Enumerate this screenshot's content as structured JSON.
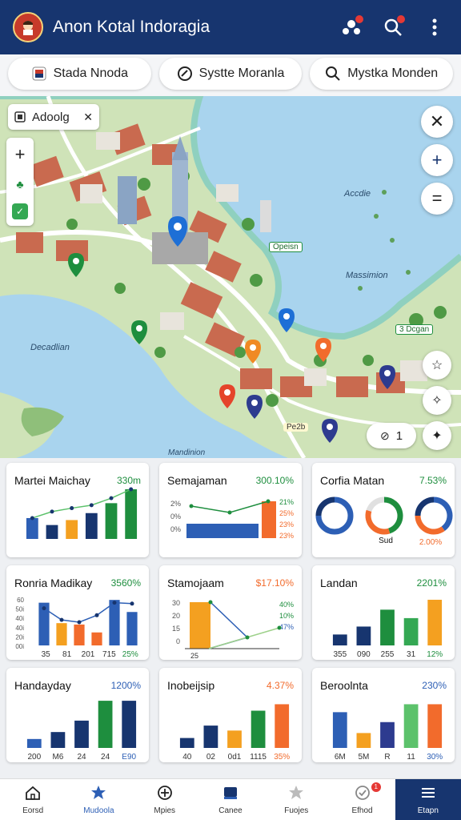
{
  "header": {
    "title": "Anon Kotal Indoragia"
  },
  "filters": [
    {
      "label": "Stada Nnoda",
      "icon": "flag-icon"
    },
    {
      "label": "Systte Moranla",
      "icon": "tag-icon"
    },
    {
      "label": "Mystka Monden",
      "icon": "search-icon"
    }
  ],
  "map": {
    "search_chip": "Adoolg",
    "labels": [
      "Accdie",
      "Massimion",
      "Decadlian",
      "Mandinion",
      "Opeisn",
      "3 Dcgan",
      "Pe2b"
    ],
    "count_badge": "1"
  },
  "cards": [
    {
      "title": "Martei Maichay",
      "value": "330m",
      "value_color": "#1e8e3e",
      "type": "bar-line",
      "values": [
        0.42,
        0.28,
        0.38,
        0.52,
        0.72,
        1.0
      ],
      "colors": [
        "#2d5fb5",
        "#17356f",
        "#f4a020",
        "#17356f",
        "#1e8e3e",
        "#1e8e3e"
      ],
      "line": [
        0.42,
        0.55,
        0.62,
        0.68,
        0.82,
        1.0
      ]
    },
    {
      "title": "Semajaman",
      "value": "300.10%",
      "value_color": "#1e8e3e",
      "type": "hbar",
      "ticks": [
        "2%",
        "0%",
        "0%"
      ],
      "right_ticks": [
        "21%",
        "25%",
        "23%",
        "23%"
      ]
    },
    {
      "title": "Corfia Matan",
      "value": "7.53%",
      "value_color": "#1e8e3e",
      "type": "donut",
      "sub_label": "Sud",
      "sub_value": "2.00%"
    },
    {
      "title": "Ronria Madikay",
      "value": "3560%",
      "value_color": "#1e8e3e",
      "type": "bar-line",
      "values": [
        0.92,
        0.48,
        0.45,
        0.28,
        0.98,
        0.72
      ],
      "colors": [
        "#2d5fb5",
        "#f4a020",
        "#f26b2c",
        "#f26b2c",
        "#2d5fb5",
        "#2d5fb5"
      ],
      "line": [
        0.8,
        0.55,
        0.5,
        0.65,
        0.92,
        0.9
      ],
      "y_ticks": [
        "60",
        "50i",
        "40i",
        "40i",
        "20i",
        "00i"
      ],
      "x_ticks": [
        "35",
        "81",
        "201",
        "715",
        "25%"
      ]
    },
    {
      "title": "Stamojaam",
      "value": "$17.10%",
      "value_color": "#f26b2c",
      "type": "bar-line2",
      "y_ticks": [
        "30",
        "20",
        "15",
        "0"
      ],
      "right_ticks": [
        "40%",
        "10%",
        "47%"
      ],
      "x_ticks": [
        "25"
      ]
    },
    {
      "title": "Landan",
      "value": "2201%",
      "value_color": "#1e8e3e",
      "type": "bars",
      "values": [
        0.22,
        0.38,
        0.72,
        0.55,
        0.92
      ],
      "colors": [
        "#17356f",
        "#17356f",
        "#1e8e3e",
        "#34a853",
        "#f4a020"
      ],
      "x_ticks": [
        "355",
        "090",
        "255",
        "31",
        "12%"
      ]
    },
    {
      "title": "Handayday",
      "value": "1200%",
      "value_color": "#2d5fb5",
      "type": "bars",
      "values": [
        0.18,
        0.32,
        0.55,
        0.95,
        0.95
      ],
      "colors": [
        "#2d5fb5",
        "#17356f",
        "#17356f",
        "#1e8e3e",
        "#17356f"
      ],
      "x_ticks": [
        "200",
        "M6",
        "24",
        "24",
        "E90"
      ]
    },
    {
      "title": "Inobeijsip",
      "value": "4.37%",
      "value_color": "#f26b2c",
      "type": "bars",
      "values": [
        0.2,
        0.45,
        0.35,
        0.75,
        0.88
      ],
      "colors": [
        "#17356f",
        "#17356f",
        "#f4a020",
        "#1e8e3e",
        "#f26b2c"
      ],
      "x_ticks": [
        "40",
        "02",
        "0d1",
        "1115",
        "35%"
      ]
    },
    {
      "title": "Beroolnta",
      "value": "230%",
      "value_color": "#2d5fb5",
      "type": "bars",
      "values": [
        0.72,
        0.3,
        0.52,
        0.88,
        0.88
      ],
      "colors": [
        "#2d5fb5",
        "#f4a020",
        "#2d3b8f",
        "#5cc26b",
        "#f26b2c"
      ],
      "x_ticks": [
        "6M",
        "5M",
        "R",
        "11",
        "30%"
      ]
    }
  ],
  "bottom_nav": [
    {
      "label": "Eorsd",
      "icon": "home-icon"
    },
    {
      "label": "Mudoola",
      "icon": "star-badge-icon"
    },
    {
      "label": "Mpies",
      "icon": "plus-circle-icon"
    },
    {
      "label": "Canee",
      "icon": "card-icon"
    },
    {
      "label": "Fuojes",
      "icon": "star-icon"
    },
    {
      "label": "Efhod",
      "icon": "check-icon",
      "badge": "1"
    },
    {
      "label": "Etapn",
      "icon": "menu-icon"
    }
  ]
}
